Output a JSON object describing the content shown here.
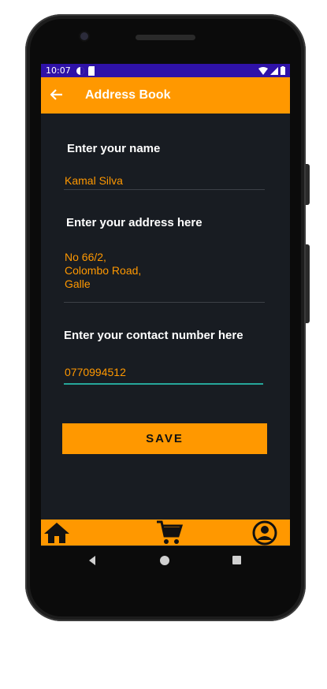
{
  "status_bar": {
    "time": "10:07"
  },
  "app_bar": {
    "back_icon": "arrow-left-icon",
    "title": "Address Book"
  },
  "form": {
    "name_label": "Enter your name",
    "name_value": "Kamal Silva",
    "address_label": "Enter your address here",
    "address_value": "No 66/2,\nColombo Road,\nGalle",
    "contact_label": "Enter your contact number here",
    "contact_value": "0770994512"
  },
  "save_button": {
    "label": "SAVE"
  },
  "bottom_nav": {
    "items": [
      "home-icon",
      "cart-icon",
      "profile-icon"
    ]
  },
  "colors": {
    "accent": "#ff9800",
    "status_bar": "#2f12a8",
    "background": "#181c22",
    "focus": "#26a69a"
  }
}
